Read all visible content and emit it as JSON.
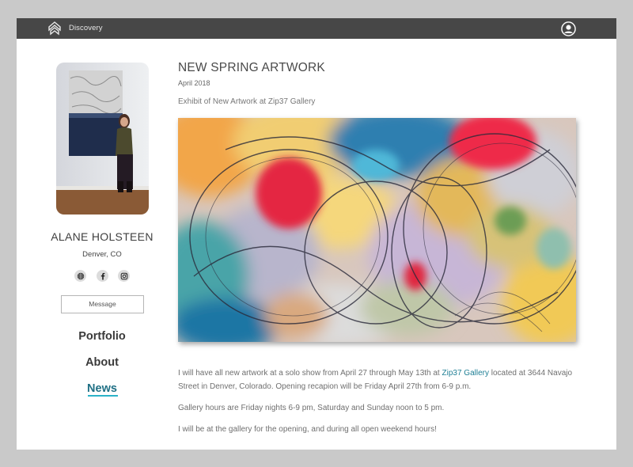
{
  "header": {
    "brand": "Discovery",
    "logo_icon": "stacked-chevron-logo",
    "user_icon": "user-circle-icon"
  },
  "profile": {
    "name": "ALANE HOLSTEEN",
    "location": "Denver, CO",
    "social_icons": [
      "globe-icon",
      "facebook-icon",
      "instagram-icon"
    ],
    "message_label": "Message"
  },
  "nav": {
    "portfolio": "Portfolio",
    "about": "About",
    "news": "News",
    "active": "News",
    "accent": "#2bb3c8"
  },
  "post": {
    "title": "NEW SPRING ARTWORK",
    "date": "April 2018",
    "subtitle": "Exhibit of New Artwork at Zip37 Gallery",
    "p1_before": "I will have all new artwork at a solo show from April 27 through May 13th at ",
    "p1_link": "Zip37 Gallery",
    "p1_after": " located at 3644 Navajo Street in Denver, Colorado. Opening recapion will be Friday April 27th from 6-9 p.m.",
    "p2": "Gallery hours are Friday nights 6-9 pm, Saturday and Sunday noon to 5 pm.",
    "p3": "I will be at the gallery for the opening, and during all open weekend hours!"
  },
  "colors": {
    "topbar": "#474747",
    "link": "#1f7f95",
    "page_bg": "#c9c9c9"
  }
}
